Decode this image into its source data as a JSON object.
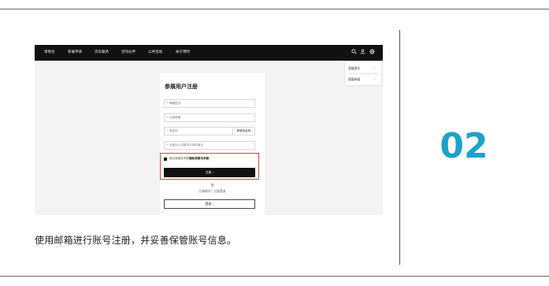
{
  "step_number": "02",
  "caption": "使用邮箱进行账号注册，并妥善保管账号信息。",
  "colors": {
    "accent": "#1aa3c9",
    "highlight_border": "#e0443c",
    "nav_bg": "#111111"
  },
  "screenshot": {
    "nav_items": [
      "项目合",
      "参展申请",
      "页车服务",
      "合作伙伴",
      "公共活动",
      "关于博时"
    ],
    "nav_icons": [
      "search-icon",
      "user-icon",
      "globe-icon"
    ],
    "dropdown": {
      "items": [
        "观展报名",
        "观展参展"
      ],
      "chevron": "›"
    },
    "form": {
      "title": "参展用户注册",
      "fields": [
        {
          "placeholder": "* 邮箱姓名"
        },
        {
          "placeholder": "* 注册邮箱"
        },
        {
          "placeholder": "* 验证码",
          "action": "获取验证码"
        },
        {
          "placeholder": "* 长度为六位数号字母的组合"
        }
      ],
      "agree_prefix": "我已阅读并同意",
      "agree_link": "隐私政策与条款",
      "submit_label": "注册  ›",
      "or_label": "或",
      "alt_label": "已有账号？立即登录",
      "login_label": "登录  ›"
    }
  }
}
